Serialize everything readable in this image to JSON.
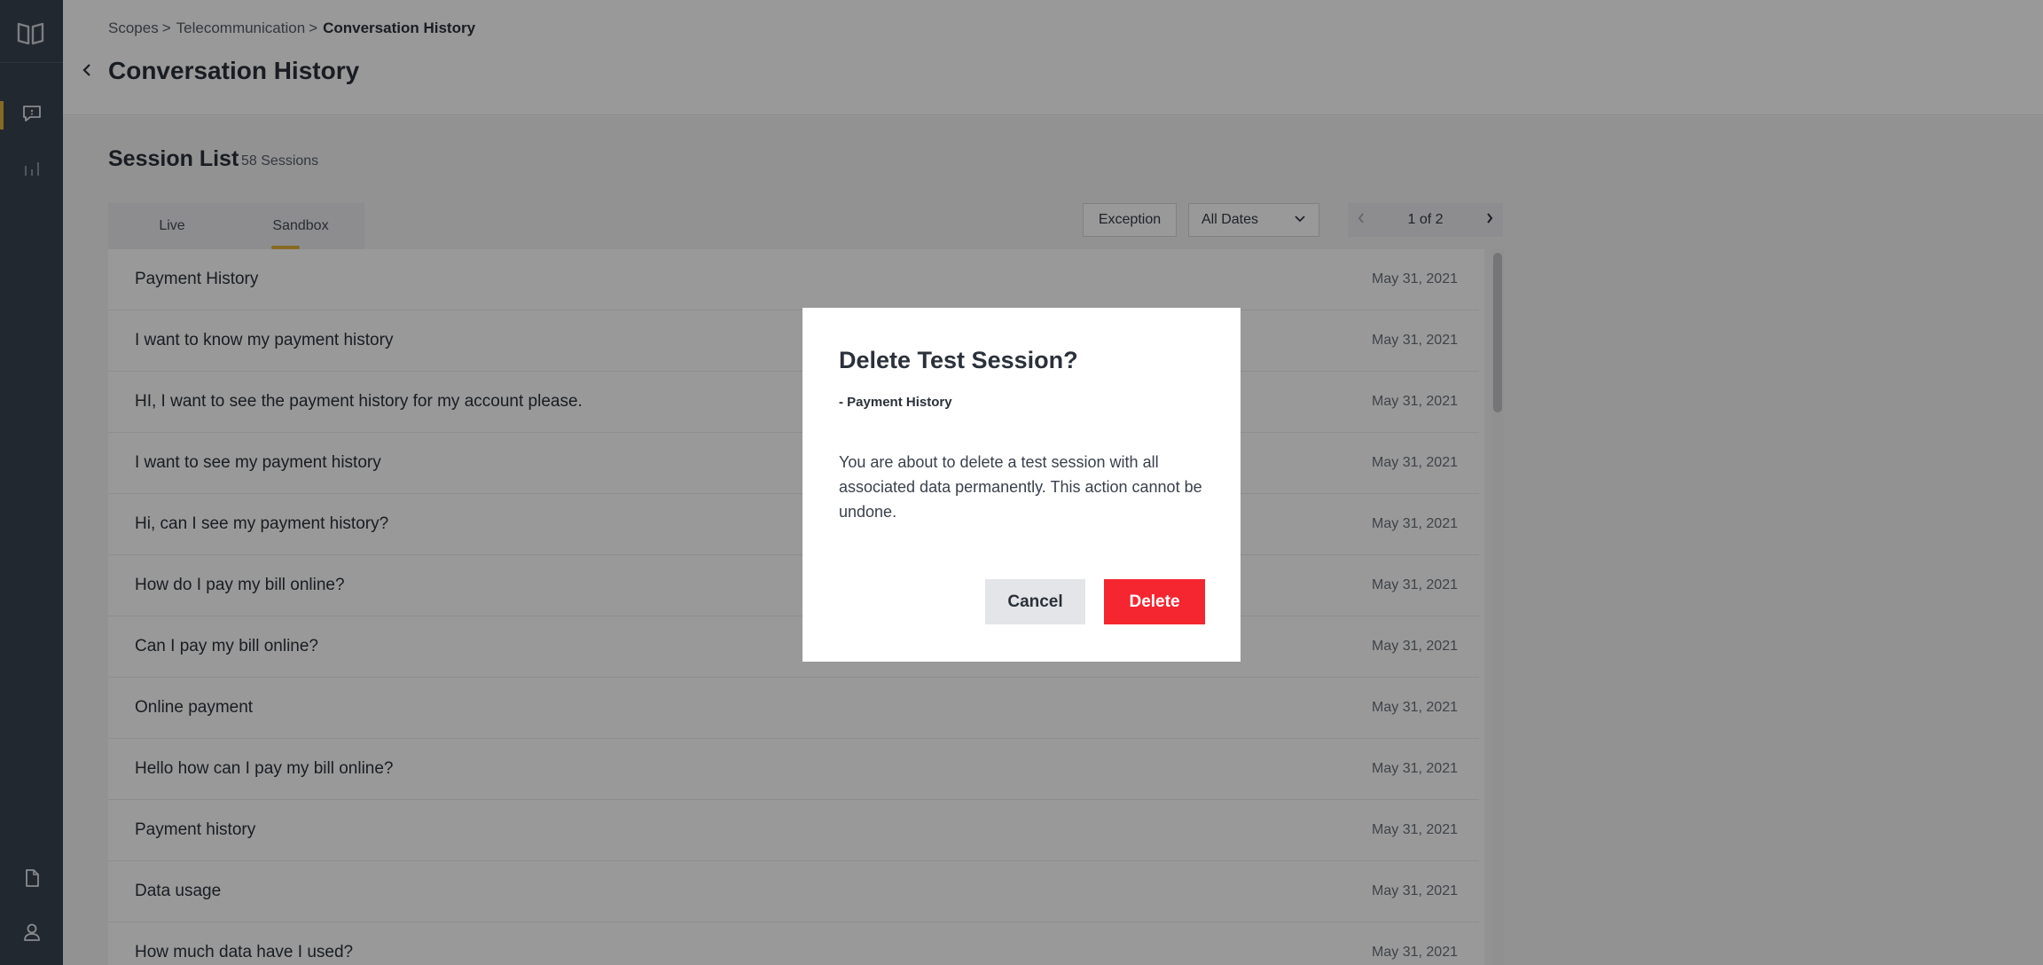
{
  "breadcrumb": {
    "items": [
      "Scopes",
      "Telecommunication"
    ],
    "separator": ">",
    "current": "Conversation History"
  },
  "page": {
    "title": "Conversation History"
  },
  "session_list": {
    "title": "Session List",
    "count": "58 Sessions",
    "tabs": [
      {
        "label": "Live",
        "active": false
      },
      {
        "label": "Sandbox",
        "active": true
      }
    ],
    "filters": {
      "exception_label": "Exception",
      "date_selected": "All Dates"
    },
    "pager": {
      "text": "1 of 2"
    },
    "rows": [
      {
        "title": "Payment History",
        "date": "May 31, 2021"
      },
      {
        "title": "I want to know my payment history",
        "date": "May 31, 2021"
      },
      {
        "title": "HI, I want to see the payment history for my account please.",
        "date": "May 31, 2021"
      },
      {
        "title": "I want to see my payment history",
        "date": "May 31, 2021"
      },
      {
        "title": "Hi, can I see my payment history?",
        "date": "May 31, 2021"
      },
      {
        "title": "How do I pay my bill online?",
        "date": "May 31, 2021"
      },
      {
        "title": "Can I pay my bill online?",
        "date": "May 31, 2021"
      },
      {
        "title": "Online payment",
        "date": "May 31, 2021"
      },
      {
        "title": "Hello how can I pay my bill online?",
        "date": "May 31, 2021"
      },
      {
        "title": "Payment history",
        "date": "May 31, 2021"
      },
      {
        "title": "Data usage",
        "date": "May 31, 2021"
      },
      {
        "title": "How much data have I used?",
        "date": "May 31, 2021"
      }
    ]
  },
  "modal": {
    "title": "Delete Test Session?",
    "subtitle": "- Payment History",
    "body": "You are about to delete a test session with all associated data permanently. This action cannot be undone.",
    "cancel_label": "Cancel",
    "delete_label": "Delete"
  },
  "icons": {
    "logo": "quote-logo-icon",
    "conversations": "chat-icon",
    "analytics": "bar-chart-icon",
    "documents": "document-icon",
    "user": "user-icon",
    "back": "chevron-left-icon",
    "dropdown": "chevron-down-icon",
    "prev": "chevron-left-icon",
    "next": "chevron-right-icon"
  },
  "colors": {
    "sidebar_bg": "#3a4350",
    "accent": "#e0b13c",
    "delete_button": "#f5262f",
    "cancel_button": "#e4e5e8"
  }
}
